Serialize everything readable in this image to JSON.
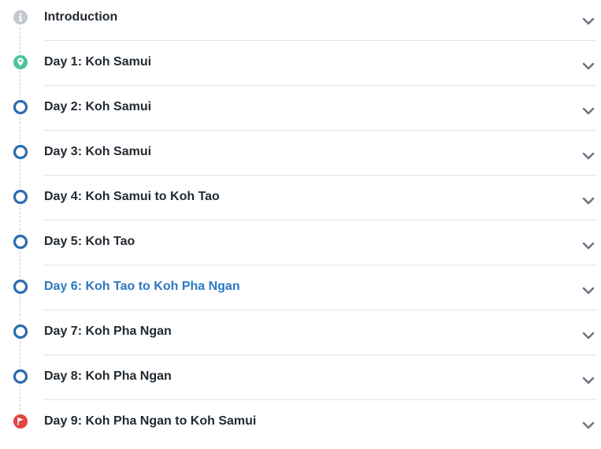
{
  "itinerary": {
    "sections": [
      {
        "label": "Introduction",
        "icon": "info-icon",
        "active": false
      },
      {
        "label": "Day 1: Koh Samui",
        "icon": "map-pin-icon",
        "active": false
      },
      {
        "label": "Day 2: Koh Samui",
        "icon": "circle-marker-icon",
        "active": false
      },
      {
        "label": "Day 3: Koh Samui",
        "icon": "circle-marker-icon",
        "active": false
      },
      {
        "label": "Day 4: Koh Samui to Koh Tao",
        "icon": "circle-marker-icon",
        "active": false
      },
      {
        "label": "Day 5: Koh Tao",
        "icon": "circle-marker-icon",
        "active": false
      },
      {
        "label": "Day 6: Koh Tao to Koh Pha Ngan",
        "icon": "circle-marker-icon",
        "active": true
      },
      {
        "label": "Day 7: Koh Pha Ngan",
        "icon": "circle-marker-icon",
        "active": false
      },
      {
        "label": "Day 8: Koh Pha Ngan",
        "icon": "circle-marker-icon",
        "active": false
      },
      {
        "label": "Day 9: Koh Pha Ngan to Koh Samui",
        "icon": "flag-icon",
        "active": false
      }
    ]
  },
  "colors": {
    "info_gray": "#c3c8ce",
    "pin_green": "#4cc39d",
    "marker_blue": "#2b6cb0",
    "flag_red": "#e0463f",
    "active_text": "#2b78c2",
    "text": "#222a33",
    "chevron": "#6d7480",
    "divider": "#dfe2e6"
  }
}
